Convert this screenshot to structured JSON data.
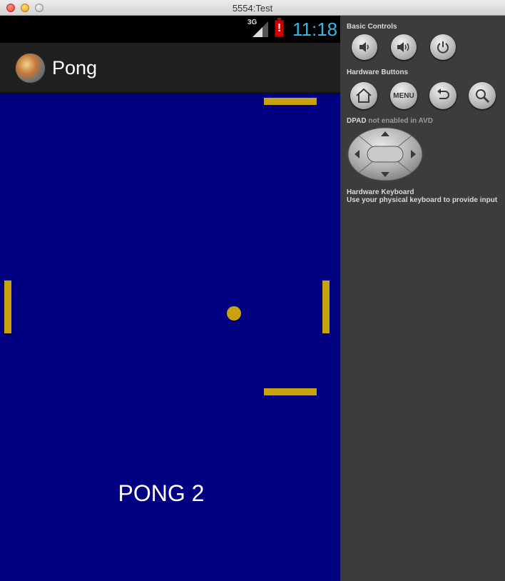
{
  "window": {
    "title": "5554:Test"
  },
  "status_bar": {
    "network": "3G",
    "battery_mark": "!",
    "time": "11:18",
    "time_color": "#33b5e5"
  },
  "action_bar": {
    "app_title": "Pong"
  },
  "game": {
    "label": "PONG 2",
    "court_color": "#000080",
    "paddle_color": "#c9a20f"
  },
  "controls": {
    "basic_title": "Basic Controls",
    "basic_buttons": [
      "volume-down-icon",
      "volume-up-icon",
      "power-icon"
    ],
    "hardware_title": "Hardware Buttons",
    "menu_label": "MENU",
    "hardware_buttons": [
      "home-icon",
      "menu-button",
      "back-icon",
      "search-icon"
    ],
    "dpad_title": "DPAD",
    "dpad_note": "not enabled in AVD",
    "keyboard_title": "Hardware Keyboard",
    "keyboard_note": "Use your physical keyboard to provide input"
  }
}
